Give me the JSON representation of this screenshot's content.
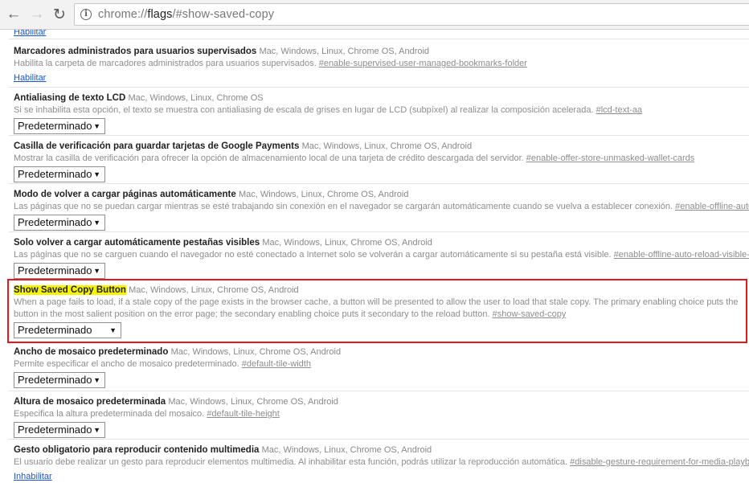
{
  "browser": {
    "url_scheme": "chrome://",
    "url_host": "flags",
    "url_path": "/#show-saved-copy",
    "back_icon": "arrow-left-icon",
    "forward_icon": "arrow-right-icon",
    "reload_icon": "reload-icon",
    "info_icon": "info-icon"
  },
  "top_link": "Habilitar",
  "experiments": [
    {
      "title": "Marcadores administrados para usuarios supervisados",
      "platforms": "Mac, Windows, Linux, Chrome OS, Android",
      "description": "Habilita la carpeta de marcadores administrados para usuarios supervisados.",
      "permalink": "#enable-supervised-user-managed-bookmarks-folder",
      "control": "link",
      "control_label": "Habilitar"
    },
    {
      "title": "Antialiasing de texto LCD",
      "platforms": "Mac, Windows, Linux, Chrome OS",
      "description": "Si se inhabilita esta opción, el texto se muestra con antialiasing de escala de grises en lugar de LCD (subpíxel) al realizar la composición acelerada.",
      "permalink": "#lcd-text-aa",
      "control": "select",
      "control_label": "Predeterminado"
    },
    {
      "title": "Casilla de verificación para guardar tarjetas de Google Payments",
      "platforms": "Mac, Windows, Linux, Chrome OS, Android",
      "description": "Mostrar la casilla de verificación para ofrecer la opción de almacenamiento local de una tarjeta de crédito descargada del servidor.",
      "permalink": "#enable-offer-store-unmasked-wallet-cards",
      "control": "select",
      "control_label": "Predeterminado"
    },
    {
      "title": "Modo de volver a cargar páginas automáticamente",
      "platforms": "Mac, Windows, Linux, Chrome OS, Android",
      "description": "Las páginas que no se puedan cargar mientras se esté trabajando sin conexión en el navegador se cargarán automáticamente cuando se vuelva a establecer conexión.",
      "permalink": "#enable-offline-auto-reload",
      "control": "select",
      "control_label": "Predeterminado"
    },
    {
      "title": "Solo volver a cargar automáticamente pestañas visibles",
      "platforms": "Mac, Windows, Linux, Chrome OS, Android",
      "description": "Las páginas que no se carguen cuando el navegador no esté conectado a Internet solo se volverán a cargar automáticamente si su pestaña está visible.",
      "permalink": "#enable-offline-auto-reload-visible-only",
      "control": "select",
      "control_label": "Predeterminado"
    },
    {
      "title": "Show Saved Copy Button",
      "platforms": "Mac, Windows, Linux, Chrome OS, Android",
      "description": "When a page fails to load, if a stale copy of the page exists in the browser cache, a button will be presented to allow the user to load that stale copy. The primary enabling choice puts the button in the most salient position on the error page; the secondary enabling choice puts it secondary to the reload button.",
      "permalink": "#show-saved-copy",
      "control": "select",
      "control_label": "Predeterminado",
      "highlighted": true
    },
    {
      "title": "Ancho de mosaico predeterminado",
      "platforms": "Mac, Windows, Linux, Chrome OS, Android",
      "description": "Permite especificar el ancho de mosaico predeterminado.",
      "permalink": "#default-tile-width",
      "control": "select",
      "control_label": "Predeterminado"
    },
    {
      "title": "Altura de mosaico predeterminada",
      "platforms": "Mac, Windows, Linux, Chrome OS, Android",
      "description": "Especifica la altura predeterminada del mosaico.",
      "permalink": "#default-tile-height",
      "control": "select",
      "control_label": "Predeterminado"
    },
    {
      "title": "Gesto obligatorio para reproducir contenido multimedia",
      "platforms": "Mac, Windows, Linux, Chrome OS, Android",
      "description": "El usuario debe realizar un gesto para reproducir elementos multimedia. Al inhabilitar esta función, podrás utilizar la reproducción automática.",
      "permalink": "#disable-gesture-requirement-for-media-playback",
      "control": "link",
      "control_label": "Inhabilitar"
    }
  ],
  "colors": {
    "highlight_border": "#e8171b",
    "title_highlight": "#f6f400",
    "link": "#1a55c9"
  }
}
